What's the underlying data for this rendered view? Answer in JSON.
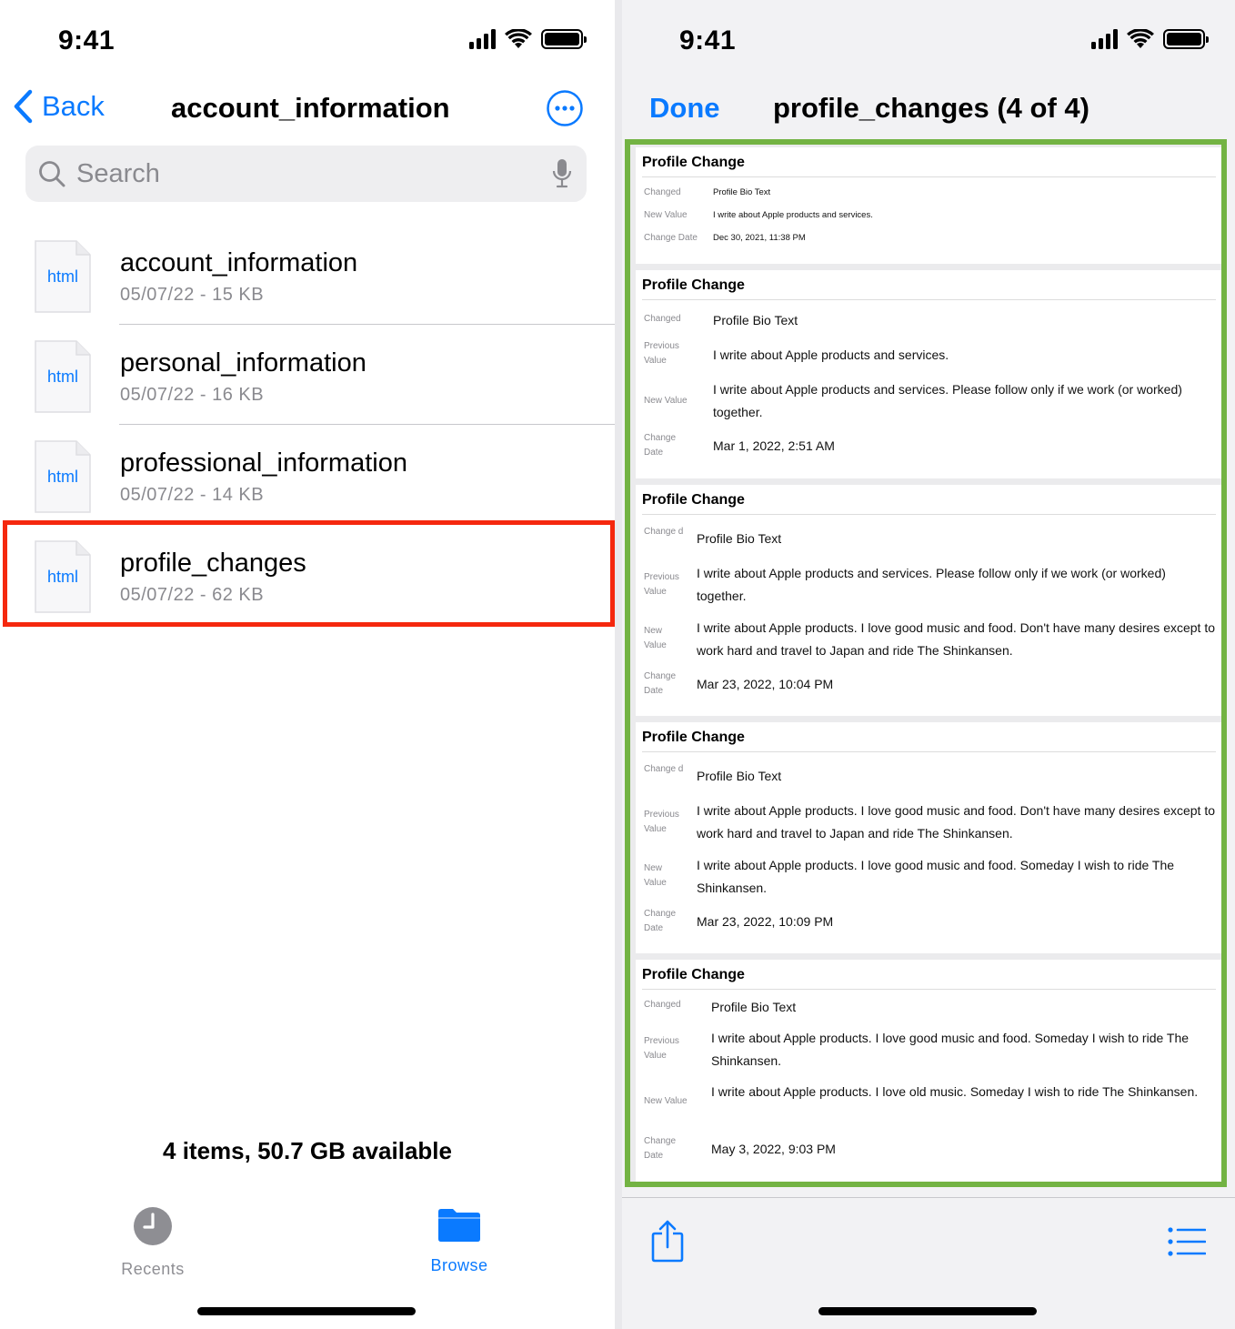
{
  "left": {
    "status": {
      "time": "9:41"
    },
    "nav": {
      "back_label": "Back",
      "title": "account_information"
    },
    "search": {
      "placeholder": "Search"
    },
    "files": [
      {
        "name": "account_information",
        "meta": "05/07/22 - 15 KB",
        "ext": "html"
      },
      {
        "name": "personal_information",
        "meta": "05/07/22 - 16 KB",
        "ext": "html"
      },
      {
        "name": "professional_information",
        "meta": "05/07/22 - 14 KB",
        "ext": "html"
      },
      {
        "name": "profile_changes",
        "meta": "05/07/22 - 62 KB",
        "ext": "html"
      }
    ],
    "storage": "4 items, 50.7 GB available",
    "tabs": {
      "recents": "Recents",
      "browse": "Browse"
    }
  },
  "right": {
    "status": {
      "time": "9:41"
    },
    "nav": {
      "done_label": "Done",
      "title": "profile_changes (4 of 4)"
    },
    "cards": [
      {
        "heading": "Profile Change",
        "rows": [
          {
            "label": "Changed",
            "value": "Profile Bio Text"
          },
          {
            "label": "New Value",
            "value": "I write about Apple products and services."
          },
          {
            "label": "Change Date",
            "value": "Dec 30, 2021, 11:38 PM"
          }
        ]
      },
      {
        "heading": "Profile Change",
        "rows": [
          {
            "label": "Changed",
            "value": "Profile Bio Text"
          },
          {
            "label": "Previous Value",
            "value": "I write about Apple products and services."
          },
          {
            "label": "New Value",
            "value": "I write about Apple products and services. Please follow only if we work (or worked) together."
          },
          {
            "label": "Change Date",
            "value": "Mar 1, 2022, 2:51 AM"
          }
        ]
      },
      {
        "heading": "Profile Change",
        "rows": [
          {
            "label": "Change d",
            "value": "Profile Bio Text"
          },
          {
            "label": "Previous Value",
            "value": "I write about Apple products and services. Please follow only if we work (or worked) together."
          },
          {
            "label": "New Value",
            "value": "I write about Apple products. I love good music and food. Don't have many desires except to work hard and travel to Japan and ride The Shinkansen."
          },
          {
            "label": "Change Date",
            "value": "Mar 23, 2022, 10:04 PM"
          }
        ]
      },
      {
        "heading": "Profile Change",
        "rows": [
          {
            "label": "Change d",
            "value": "Profile Bio Text"
          },
          {
            "label": "Previous Value",
            "value": "I write about Apple products. I love good music and food. Don't have many desires except to work hard and travel to Japan and ride The Shinkansen."
          },
          {
            "label": "New Value",
            "value": "I write about Apple products. I love good music and food. Someday I wish to ride The Shinkansen."
          },
          {
            "label": "Change Date",
            "value": "Mar 23, 2022, 10:09 PM"
          }
        ]
      },
      {
        "heading": "Profile Change",
        "rows": [
          {
            "label": "Changed",
            "value": "Profile Bio Text"
          },
          {
            "label": "Previous Value",
            "value": "I write about Apple products. I love good music and food. Someday I wish to ride The Shinkansen."
          },
          {
            "label": "New Value",
            "value": "I write about Apple products. I love old music. Someday I wish to ride The Shinkansen."
          },
          {
            "label": "Change Date",
            "value": "May 3, 2022, 9:03 PM"
          }
        ]
      }
    ]
  },
  "colors": {
    "accent": "#0a7aff",
    "highlight_red": "#f5280e",
    "highlight_green": "#73b343"
  },
  "icons": [
    "chevron-left-icon",
    "more-icon",
    "search-icon",
    "mic-icon",
    "file-icon",
    "clock-icon",
    "folder-icon",
    "share-icon",
    "list-icon",
    "signal-icon",
    "wifi-icon",
    "battery-icon"
  ]
}
